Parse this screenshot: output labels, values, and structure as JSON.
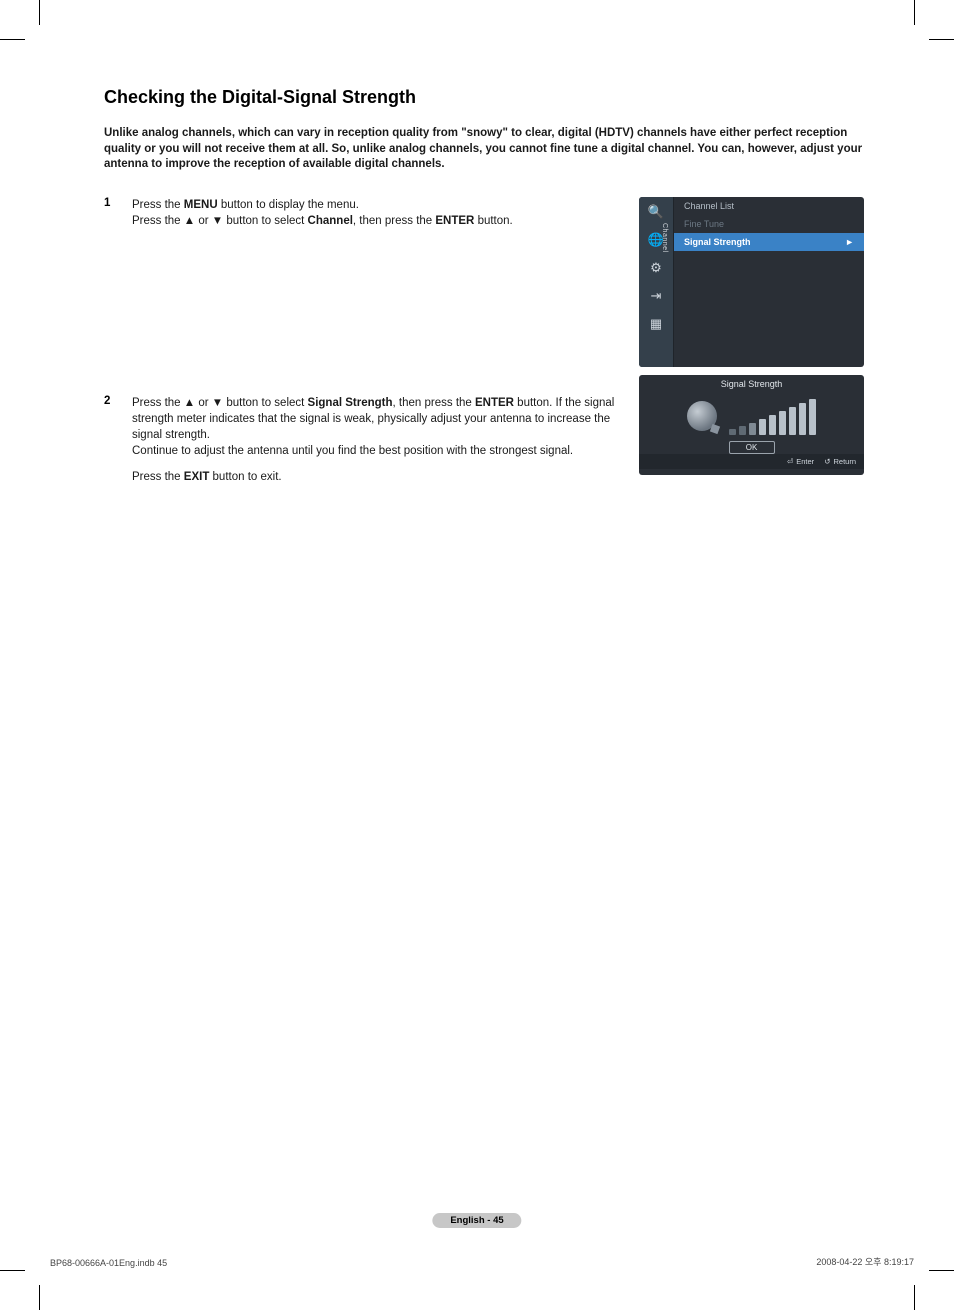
{
  "title": "Checking the Digital-Signal Strength",
  "intro": "Unlike analog channels, which can vary in reception quality from \"snowy\" to clear, digital (HDTV) channels have either perfect reception quality or you will not receive them at all. So, unlike analog channels, you cannot fine tune a digital channel. You can, however, adjust your antenna to improve the reception of available digital channels.",
  "step1": {
    "num": "1",
    "line1_a": "Press the ",
    "line1_b": "MENU",
    "line1_c": " button to display the menu.",
    "line2_a": "Press the ▲ or ▼ button to select ",
    "line2_b": "Channel",
    "line2_c": ", then press the ",
    "line2_d": "ENTER",
    "line2_e": " button."
  },
  "step2": {
    "num": "2",
    "body_a": "Press the ▲ or ▼ button to select ",
    "body_b": "Signal Strength",
    "body_c": ", then press the ",
    "body_d": "ENTER",
    "body_e": " button. If the signal strength meter indicates that the signal is weak, physically adjust your antenna to increase the signal strength.",
    "body_f": "Continue to adjust the antenna until you find the best position with the strongest signal.",
    "exit_a": "Press the ",
    "exit_b": "EXIT",
    "exit_c": " button to exit."
  },
  "osd": {
    "tab": "Channel",
    "items": {
      "channel_list": "Channel List",
      "fine_tune": "Fine Tune",
      "signal_strength": "Signal Strength"
    }
  },
  "signal": {
    "title": "Signal Strength",
    "ok": "OK",
    "enter": "Enter",
    "ret": "Return"
  },
  "page_badge": "English - 45",
  "footer_left": "BP68-00666A-01Eng.indb   45",
  "footer_right": "2008-04-22   오후 8:19:17"
}
